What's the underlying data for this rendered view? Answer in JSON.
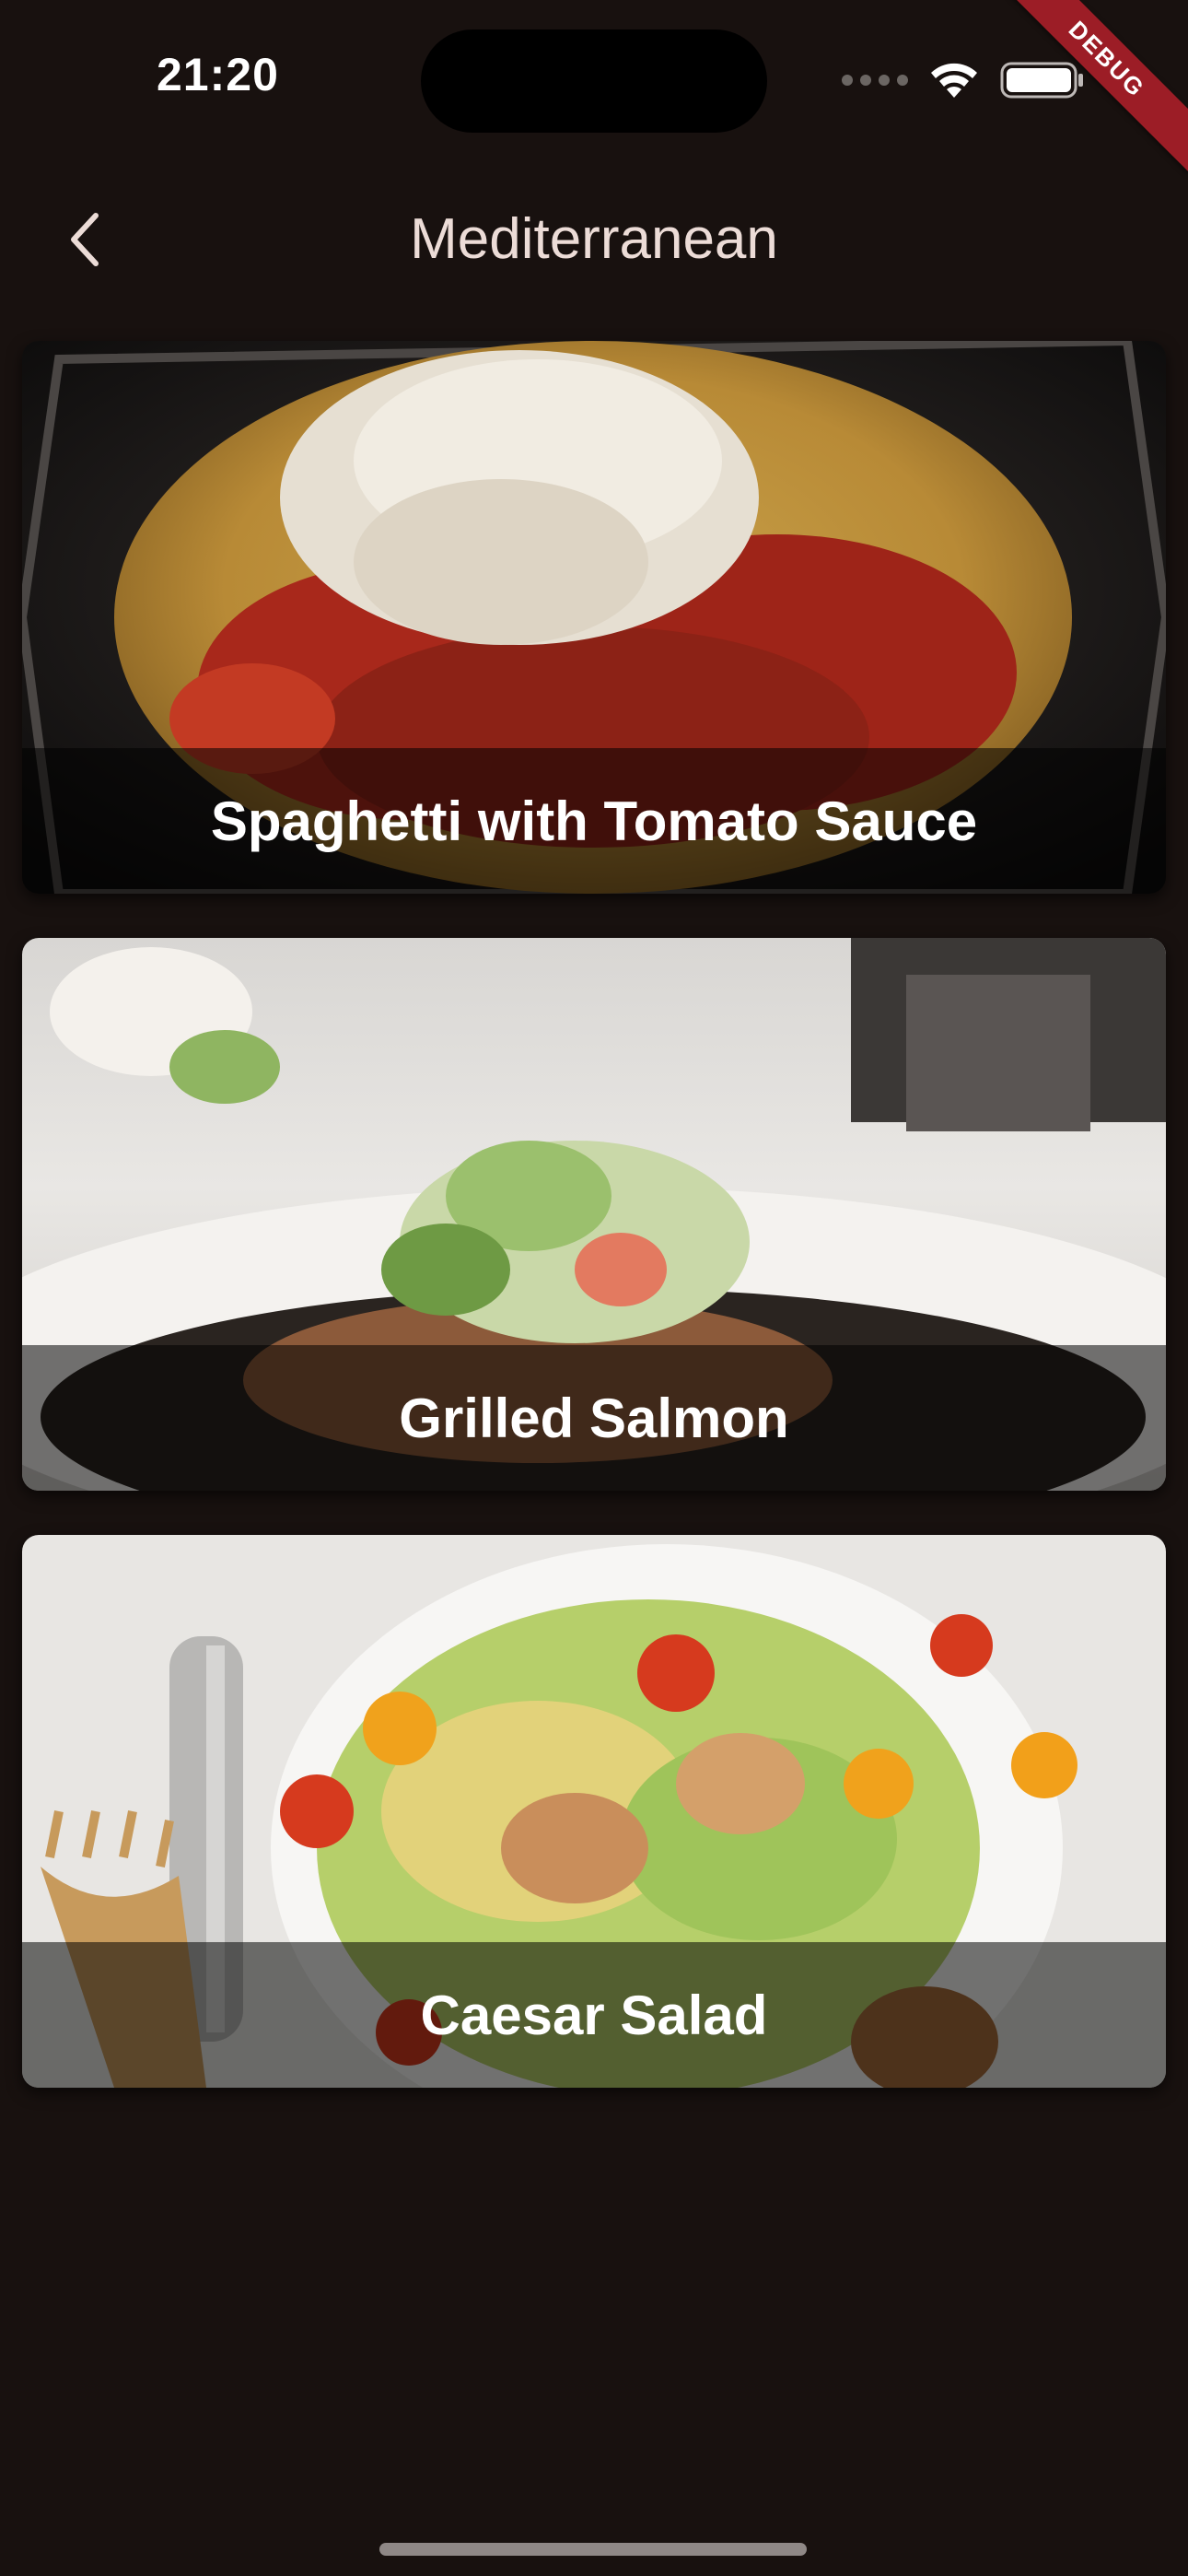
{
  "status_bar": {
    "time": "21:20",
    "signal_icon": "cellular-signal-icon",
    "wifi_icon": "wifi-icon",
    "battery_icon": "battery-icon"
  },
  "debug_banner": {
    "label": "DEBUG",
    "color": "#9c1d26"
  },
  "app_bar": {
    "back_icon": "chevron-left-icon",
    "title": "Mediterranean"
  },
  "meals": [
    {
      "title": "Spaghetti with Tomato Sauce",
      "image": "spaghetti-photo"
    },
    {
      "title": "Grilled Salmon",
      "image": "grilled-salmon-photo"
    },
    {
      "title": "Caesar Salad",
      "image": "caesar-salad-photo"
    }
  ],
  "colors": {
    "background": "#18110f",
    "title_text": "#ecdcd7",
    "caption_overlay": "rgba(0,0,0,0.54)"
  }
}
